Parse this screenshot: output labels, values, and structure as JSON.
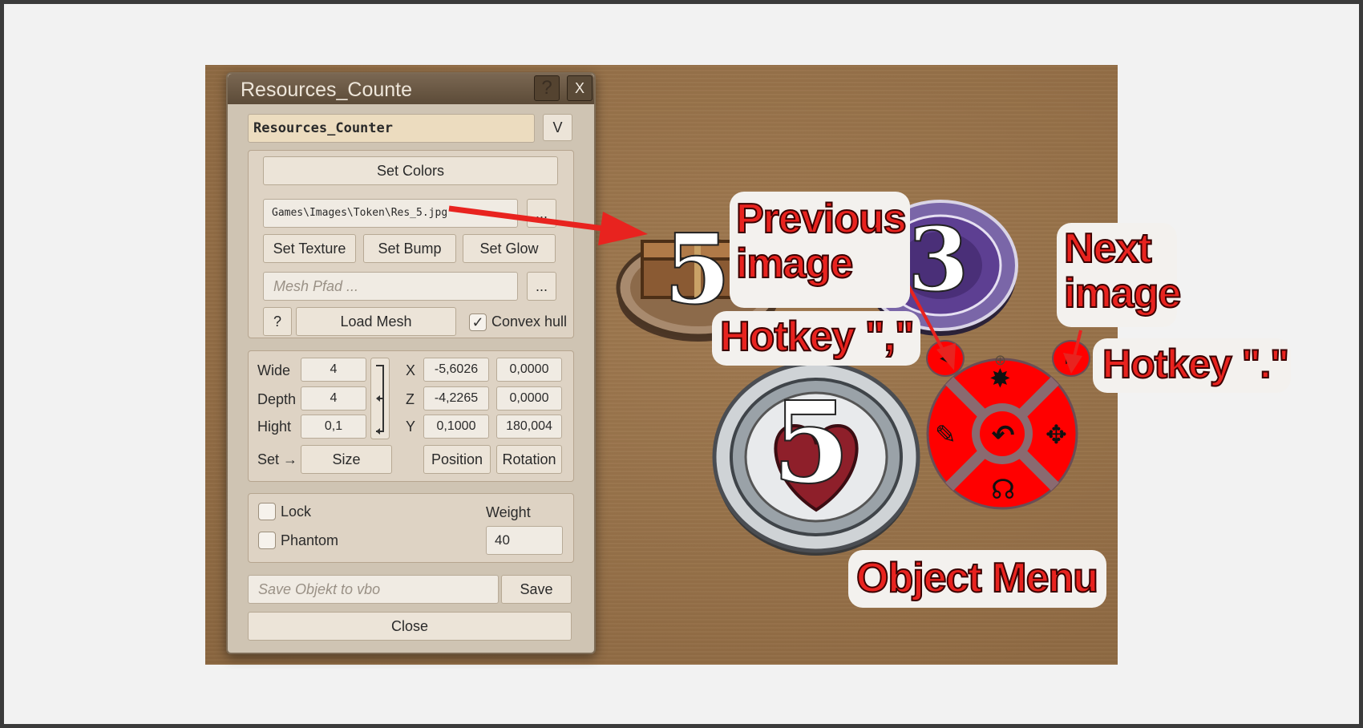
{
  "dialog": {
    "title": "Resources_Counte",
    "help_label": "?",
    "close_x_label": "X",
    "name_value": "Resources_Counter",
    "v_label": "V",
    "set_colors_label": "Set Colors",
    "texture_path": "Games\\Images\\Token\\Res_5.jpg",
    "browse_label": "...",
    "set_texture_label": "Set Texture",
    "set_bump_label": "Set Bump",
    "set_glow_label": "Set Glow",
    "mesh_placeholder": "Mesh Pfad ...",
    "mesh_browse_label": "...",
    "mesh_help_label": "?",
    "load_mesh_label": "Load Mesh",
    "convex_hull_label": "Convex hull",
    "convex_hull_checked": true,
    "dims": {
      "wide_label": "Wide",
      "wide_value": "4",
      "depth_label": "Depth",
      "depth_value": "4",
      "hight_label": "Hight",
      "hight_value": "0,1",
      "x_label": "X",
      "x_pos": "-5,6026",
      "x_rot": "0,0000",
      "z_label": "Z",
      "z_pos": "-4,2265",
      "z_rot": "0,0000",
      "y_label": "Y",
      "y_pos": "0,1000",
      "y_rot": "180,004",
      "set_label": "Set →",
      "size_label": "Size",
      "position_label": "Position",
      "rotation_label": "Rotation"
    },
    "lock_label": "Lock",
    "phantom_label": "Phantom",
    "weight_label": "Weight",
    "weight_value": "40",
    "save_placeholder": "Save Objekt to vbo",
    "save_label": "Save",
    "close_label": "Close"
  },
  "tokens": {
    "chest_number": "5",
    "purple_number": "3",
    "heart_number": "5"
  },
  "annotations": {
    "previous_image": "Previous\nimage",
    "hotkey_comma": "Hotkey \",\"",
    "next_image": "Next\nimage",
    "hotkey_dot": "Hotkey \".\"",
    "object_menu": "Object Menu"
  },
  "colors": {
    "annotation_red": "#e8231f",
    "menu_red": "#ff0000",
    "table_wood": "#957048"
  },
  "icons": [
    "question-icon",
    "close-icon",
    "checkmark-icon",
    "prev-image-icon",
    "next-image-icon",
    "explode-icon",
    "pipette-icon",
    "move-icon",
    "rotate-icon",
    "hands-icon",
    "crosshair-icon"
  ]
}
